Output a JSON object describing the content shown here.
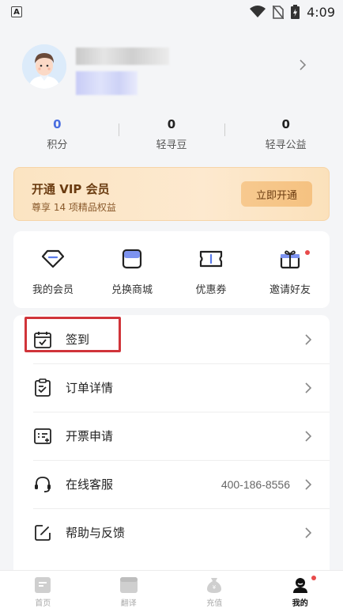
{
  "status_bar": {
    "time": "4:09",
    "left_icon": "a-letter-icon",
    "icons": [
      "wifi-icon",
      "no-sim-icon",
      "battery-charging-icon"
    ]
  },
  "profile": {
    "avatar": "avatar-icon",
    "chevron": "chevron-right-icon"
  },
  "stats": [
    {
      "value": "0",
      "label": "积分"
    },
    {
      "value": "0",
      "label": "轻寻豆"
    },
    {
      "value": "0",
      "label": "轻寻公益"
    }
  ],
  "vip": {
    "title": "开通 VIP 会员",
    "subtitle": "尊享 14 项精品权益",
    "button": "立即开通"
  },
  "quick_actions": [
    {
      "label": "我的会员",
      "icon": "diamond-icon"
    },
    {
      "label": "兑换商城",
      "icon": "store-icon"
    },
    {
      "label": "优惠券",
      "icon": "coupon-icon"
    },
    {
      "label": "邀请好友",
      "icon": "gift-icon"
    }
  ],
  "menu": [
    {
      "label": "签到",
      "icon": "calendar-check-icon",
      "value": ""
    },
    {
      "label": "订单详情",
      "icon": "clipboard-check-icon",
      "value": ""
    },
    {
      "label": "开票申请",
      "icon": "invoice-icon",
      "value": ""
    },
    {
      "label": "在线客服",
      "icon": "headset-icon",
      "value": "400-186-8556"
    },
    {
      "label": "帮助与反馈",
      "icon": "edit-feedback-icon",
      "value": ""
    }
  ],
  "tabs": [
    {
      "label": "首页",
      "icon": "home-doc-icon"
    },
    {
      "label": "翻译",
      "icon": "translate-folder-icon"
    },
    {
      "label": "充值",
      "icon": "money-bag-icon"
    },
    {
      "label": "我的",
      "icon": "profile-icon"
    }
  ],
  "colors": {
    "accent_blue": "#4a6ee0",
    "vip_text": "#6a3b10",
    "highlight_red": "#d0343a",
    "notify_red": "#e84a4a"
  }
}
